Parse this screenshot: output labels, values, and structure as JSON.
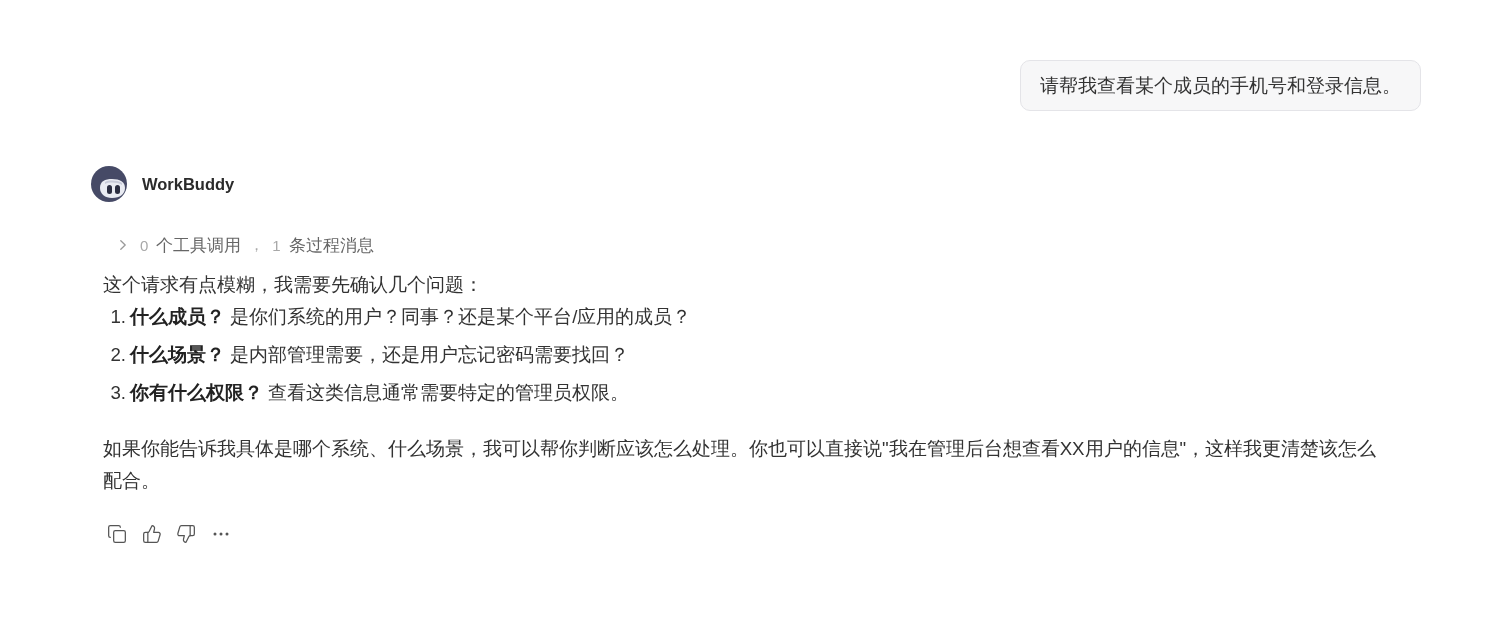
{
  "user_message": {
    "text": "请帮我查看某个成员的手机号和登录信息。"
  },
  "assistant": {
    "name": "WorkBuddy",
    "process_summary": {
      "expanded": false,
      "tool_count": "0",
      "tool_label": "个工具调用",
      "separator": "，",
      "message_count": "1",
      "message_label": "条过程消息"
    },
    "intro": "这个请求有点模糊，我需要先确认几个问题：",
    "questions": [
      {
        "number": "1.",
        "text": "**什么成员？** 是你们系统的用户？同事？还是某个平台/应用的成员？"
      },
      {
        "number": "2.",
        "text": "**什么场景？** 是内部管理需要，还是用户忘记密码需要找回？"
      },
      {
        "number": "3.",
        "text": "**你有什么权限？** 查看这类信息通常需要特定的管理员权限。"
      }
    ],
    "closing": "如果你能告诉我具体是哪个系统、什么场景，我可以帮你判断应该怎么处理。你也可以直接说\"我在管理后台想查看XX用户的信息\"，这样我更清楚该怎么配合。",
    "actions": [
      {
        "kind": "copy"
      },
      {
        "kind": "like"
      },
      {
        "kind": "dislike"
      },
      {
        "kind": "more"
      }
    ]
  }
}
